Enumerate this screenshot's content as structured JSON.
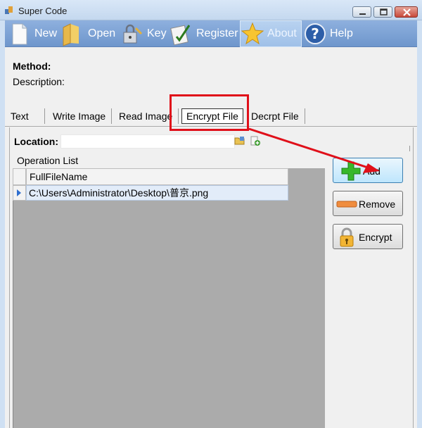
{
  "window": {
    "title": "Super Code"
  },
  "toolbar": {
    "items": [
      {
        "label": "New",
        "icon": "new-document-icon"
      },
      {
        "label": "Open",
        "icon": "folder-icon"
      },
      {
        "label": "Key",
        "icon": "lock-key-icon"
      },
      {
        "label": "Register",
        "icon": "register-pen-icon"
      },
      {
        "label": "About",
        "icon": "star-icon",
        "active": true
      },
      {
        "label": "Help",
        "icon": "help-question-icon"
      }
    ]
  },
  "info": {
    "method_label": "Method:",
    "description_label": "Description:"
  },
  "tabs": [
    {
      "label": "Text"
    },
    {
      "label": "Write Image"
    },
    {
      "label": "Read Image"
    },
    {
      "label": "Encrypt File",
      "active": true
    },
    {
      "label": "Decrpt File"
    }
  ],
  "location": {
    "label": "Location:",
    "value": ""
  },
  "operation_list": {
    "label": "Operation List",
    "columns": [
      "FullFileName"
    ],
    "rows": [
      [
        "C:\\Users\\Administrator\\Desktop\\普京.png"
      ]
    ]
  },
  "side_buttons": {
    "add": "Add",
    "remove": "Remove",
    "encrypt": "Encrypt"
  },
  "colors": {
    "toolbar": "#7ea3d6",
    "highlight": "#e0101a",
    "grid_bg": "#ababab",
    "selected_row": "#e2ecf9"
  }
}
